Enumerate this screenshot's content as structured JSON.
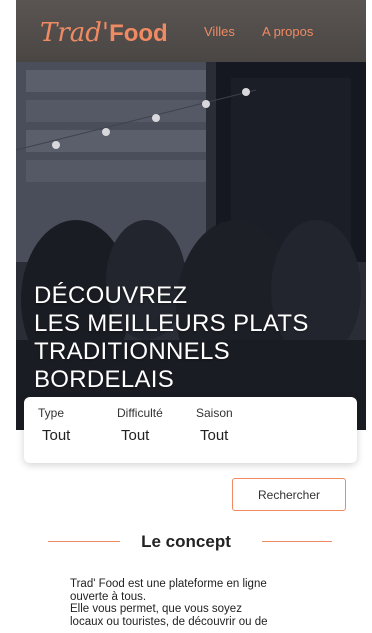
{
  "header": {
    "logo_script": "Trad'",
    "logo_bold": "Food",
    "nav": [
      {
        "label": "Villes"
      },
      {
        "label": "A propos"
      }
    ]
  },
  "hero": {
    "title_lines": [
      "DÉCOUVREZ",
      "LES MEILLEURS PLATS",
      "TRADITIONNELS",
      "BORDELAIS"
    ]
  },
  "filters": [
    {
      "label": "Type",
      "value": "Tout"
    },
    {
      "label": "Difficulté",
      "value": "Tout"
    },
    {
      "label": "Saison",
      "value": "Tout"
    }
  ],
  "search": {
    "label": "Rechercher"
  },
  "concept": {
    "title": "Le concept",
    "lines": [
      "Trad' Food est une plateforme en ligne",
      "ouverte à tous.",
      "Elle vous permet, que vous soyez",
      "locaux ou touristes, de découvrir ou de"
    ]
  },
  "colors": {
    "accent": "#f08a62",
    "hero_overlay": "#2b2f39"
  }
}
